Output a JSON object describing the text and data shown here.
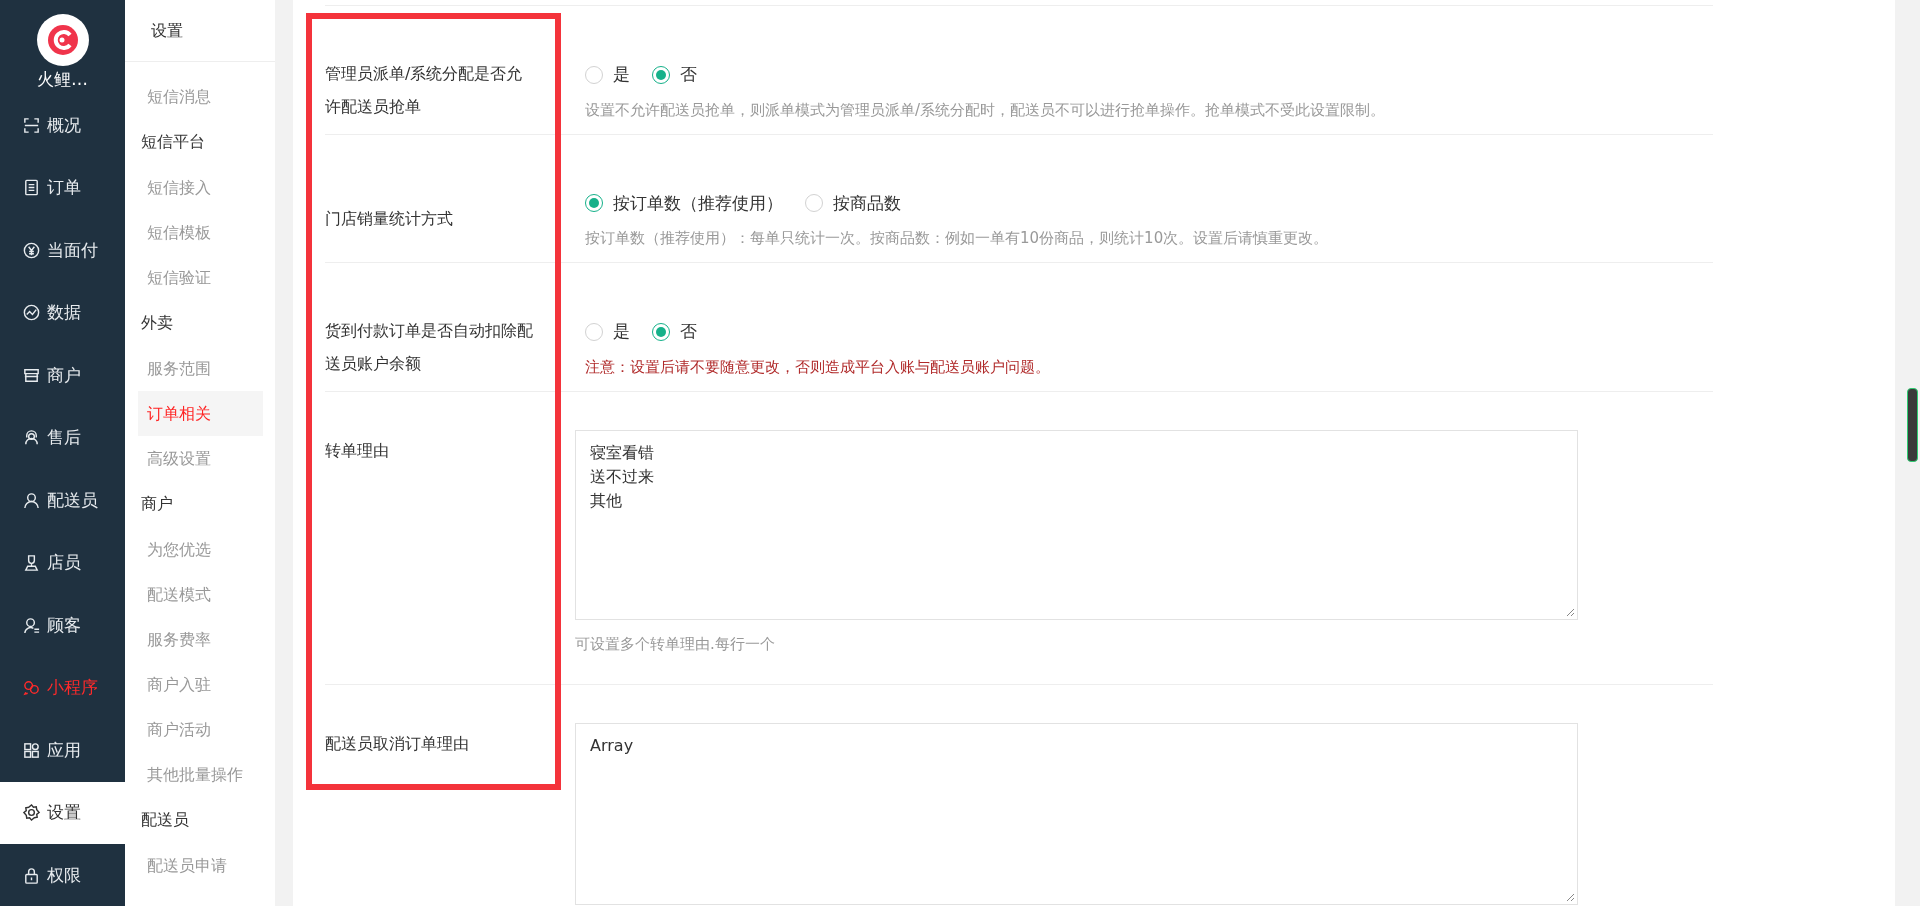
{
  "sidebar": {
    "logo_text": "火鲤…",
    "items": [
      {
        "label": "概况",
        "selected": false,
        "highlighted": false
      },
      {
        "label": "订单",
        "selected": false,
        "highlighted": false
      },
      {
        "label": "当面付",
        "selected": false,
        "highlighted": false
      },
      {
        "label": "数据",
        "selected": false,
        "highlighted": false
      },
      {
        "label": "商户",
        "selected": false,
        "highlighted": false
      },
      {
        "label": "售后",
        "selected": false,
        "highlighted": false
      },
      {
        "label": "配送员",
        "selected": false,
        "highlighted": false
      },
      {
        "label": "店员",
        "selected": false,
        "highlighted": false
      },
      {
        "label": "顾客",
        "selected": false,
        "highlighted": false
      },
      {
        "label": "小程序",
        "selected": false,
        "highlighted": true
      },
      {
        "label": "应用",
        "selected": false,
        "highlighted": false
      },
      {
        "label": "设置",
        "selected": true,
        "highlighted": false
      },
      {
        "label": "权限",
        "selected": false,
        "highlighted": false
      }
    ]
  },
  "submenu": {
    "title": "设置",
    "items": [
      {
        "kind": "link",
        "label": "短信消息",
        "selected": false
      },
      {
        "kind": "group",
        "label": "短信平台"
      },
      {
        "kind": "link",
        "label": "短信接入",
        "selected": false
      },
      {
        "kind": "link",
        "label": "短信模板",
        "selected": false
      },
      {
        "kind": "link",
        "label": "短信验证",
        "selected": false
      },
      {
        "kind": "group",
        "label": "外卖"
      },
      {
        "kind": "link",
        "label": "服务范围",
        "selected": false
      },
      {
        "kind": "link",
        "label": "订单相关",
        "selected": true
      },
      {
        "kind": "link",
        "label": "高级设置",
        "selected": false
      },
      {
        "kind": "group",
        "label": "商户"
      },
      {
        "kind": "link",
        "label": "为您优选",
        "selected": false
      },
      {
        "kind": "link",
        "label": "配送模式",
        "selected": false
      },
      {
        "kind": "link",
        "label": "服务费率",
        "selected": false
      },
      {
        "kind": "link",
        "label": "商户入驻",
        "selected": false
      },
      {
        "kind": "link",
        "label": "商户活动",
        "selected": false
      },
      {
        "kind": "link",
        "label": "其他批量操作",
        "selected": false
      },
      {
        "kind": "group",
        "label": "配送员"
      },
      {
        "kind": "link",
        "label": "配送员申请",
        "selected": false
      }
    ]
  },
  "form": {
    "rows": [
      {
        "kind": "radio",
        "label": "管理员派单/系统分配是否允许配送员抢单",
        "options": [
          {
            "label": "是",
            "selected": false
          },
          {
            "label": "否",
            "selected": true
          }
        ],
        "hint": "设置不允许配送员抢单，则派单模式为管理员派单/系统分配时，配送员不可以进行抢单操作。抢单模式不受此设置限制。",
        "warning": false
      },
      {
        "kind": "radio",
        "label": "门店销量统计方式",
        "options": [
          {
            "label": "按订单数（推荐使用）",
            "selected": true
          },
          {
            "label": "按商品数",
            "selected": false
          }
        ],
        "hint": "按订单数（推荐使用）：每单只统计一次。按商品数：例如一单有10份商品，则统计10次。设置后请慎重更改。",
        "warning": false
      },
      {
        "kind": "radio",
        "label": "货到付款订单是否自动扣除配送员账户余额",
        "options": [
          {
            "label": "是",
            "selected": false
          },
          {
            "label": "否",
            "selected": true
          }
        ],
        "hint": "注意：设置后请不要随意更改，否则造成平台入账与配送员账户问题。",
        "warning": true
      },
      {
        "kind": "textarea",
        "label": "转单理由",
        "lines": [
          "寝室看错",
          "送不过来",
          "其他"
        ],
        "hint": "可设置多个转单理由.每行一个",
        "warning": false
      },
      {
        "kind": "textarea",
        "label": "配送员取消订单理由",
        "lines": [
          "Array"
        ]
      }
    ]
  }
}
